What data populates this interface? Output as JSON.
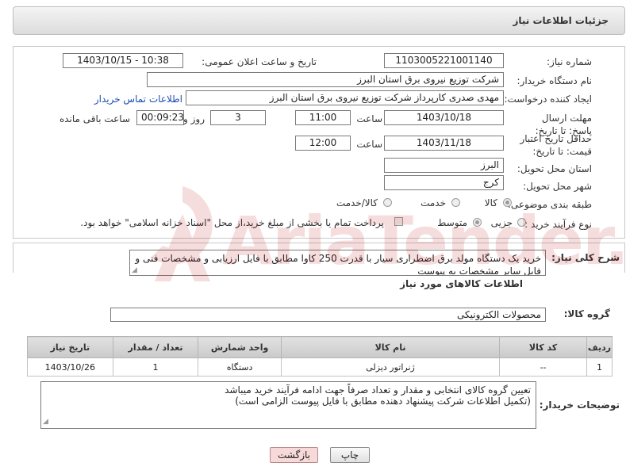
{
  "header": {
    "title": "جزئیات اطلاعات نیاز"
  },
  "form": {
    "need_number_label": "شماره نیاز:",
    "need_number": "1103005221001140",
    "announce_label": "تاریخ و ساعت اعلان عمومی:",
    "announce_value": "1403/10/15 - 10:38",
    "buyer_org_label": "نام دستگاه خریدار:",
    "buyer_org": "شرکت توزیع نیروی برق استان البرز",
    "requester_label": "ایجاد کننده درخواست:",
    "requester": "مهدی صدری کارپرداز شرکت توزیع نیروی برق استان البرز",
    "contact_link": "اطلاعات تماس خریدار",
    "deadline_label": "مهلت ارسال پاسخ: تا تاریخ:",
    "deadline_date": "1403/10/18",
    "time_label": "ساعت",
    "deadline_time": "11:00",
    "days_value": "3",
    "days_label": "روز و",
    "remaining_value": "00:09:23",
    "remaining_label": "ساعت باقی مانده",
    "validity_label": "حداقل تاریخ اعتبار قیمت: تا تاریخ:",
    "validity_date": "1403/11/18",
    "validity_time": "12:00",
    "province_label": "استان محل تحویل:",
    "province": "البرز",
    "city_label": "شهر محل تحویل:",
    "city": "کرج",
    "category_label": "طبقه بندی موضوعی:",
    "category_options": [
      "کالا",
      "خدمت",
      "کالا/خدمت"
    ],
    "process_label": "نوع فرآیند خرید :",
    "process_options": [
      "جزیی",
      "متوسط"
    ],
    "payment_note": "پرداخت تمام یا بخشی از مبلغ خرید،از محل \"اسناد خزانه اسلامی\" خواهد بود."
  },
  "description": {
    "label": "شرح کلی نیاز:",
    "text": "خرید یک دستگاه مولد برق اضطراری سیار با قدرت 250 کاوا مطابق با فایل ارزیابی و  مشخصات فنی و فایل سایر مشخصات به پیوست"
  },
  "goods": {
    "section_title": "اطلاعات کالاهای مورد نیاز",
    "group_label": "گروه کالا:",
    "group_value": "محصولات الکترونیکی",
    "columns": [
      "ردیف",
      "کد کالا",
      "نام کالا",
      "واحد شمارش",
      "تعداد / مقدار",
      "تاریخ نیاز"
    ],
    "rows": [
      [
        "1",
        "--",
        "ژنراتور دیزلی",
        "دستگاه",
        "1",
        "1403/10/26"
      ]
    ]
  },
  "buyer_notes": {
    "label": "توضیحات خریدار:",
    "line1": "تعیین گروه کالای انتخابی و مقدار و تعداد صرفاً جهت ادامه فرآیند خرید میباشد",
    "line2": "(تکمیل اطلاعات شرکت پیشنهاد دهنده مطابق با فایل پیوست الزامی است)"
  },
  "buttons": {
    "print": "چاپ",
    "back": "بازگشت"
  },
  "watermark": "AriaTender.neT",
  "colors": {
    "link": "#1a4fb0",
    "back_button": "#f7d9d9",
    "watermark": "#c20000"
  }
}
